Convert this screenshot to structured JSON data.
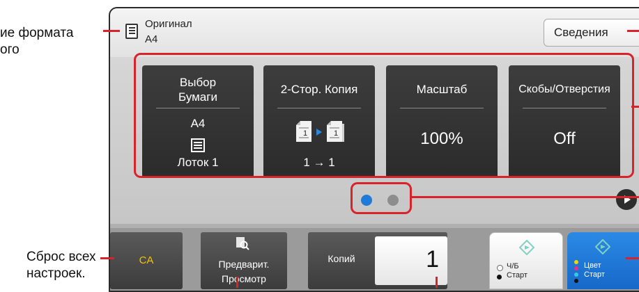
{
  "annotations": {
    "original_format_line1": "ие формата",
    "original_format_line2": "ого",
    "reset_line1": "Сброс всех",
    "reset_line2": "настроек."
  },
  "header": {
    "original_label": "Оригинал",
    "original_size": "A4",
    "info_button": "Сведения"
  },
  "tiles": [
    {
      "title_line1": "Выбор",
      "title_line2": "Бумаги",
      "size": "A4",
      "tray": "Лоток 1"
    },
    {
      "title": "2-Стор. Копия",
      "page_front": "1",
      "page_back": "1",
      "mode": "1 → 1"
    },
    {
      "title": "Масштаб",
      "value": "100%"
    },
    {
      "title": "Скобы/Отверстия",
      "value": "Off"
    }
  ],
  "pagination": {
    "current": 1,
    "total": 2,
    "active_color": "#1f7bd8",
    "inactive_color": "#8d8d8d"
  },
  "bottom": {
    "ca_label": "CA",
    "preview_line1": "Предварит.",
    "preview_line2": "Просмотр",
    "copies_label": "Копий",
    "copies_value": "1",
    "bw_start_line1": "Ч/Б",
    "bw_start_line2": "Старт",
    "color_start_line1": "Цвет",
    "color_start_line2": "Старт"
  },
  "colors": {
    "annotation_red": "#d8232a",
    "ca_text": "#f3c400",
    "color_start_bg": "#1f78d6",
    "start_icon": "#7fd2c2"
  },
  "icons": [
    "document-icon",
    "info-arrow-icon",
    "tray-icon",
    "duplex-pages-icon",
    "preview-magnifier-icon",
    "start-diamond-icon",
    "next-page-icon"
  ]
}
